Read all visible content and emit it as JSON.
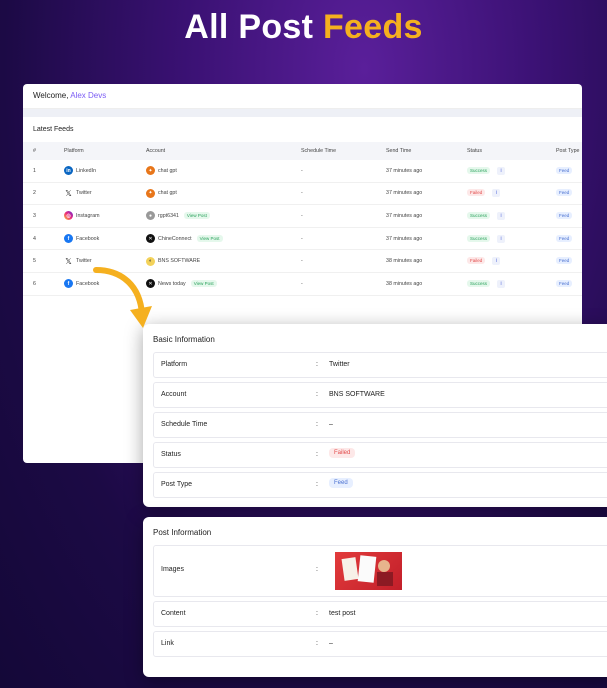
{
  "hero": {
    "title_plain": "All Post",
    "title_highlight": "Feeds"
  },
  "welcome": {
    "prefix": "Welcome,",
    "name": "Alex Devs"
  },
  "feeds": {
    "title": "Latest Feeds",
    "columns": [
      "#",
      "Platform",
      "Account",
      "Schedule Time",
      "Send Time",
      "Status",
      "Post Type"
    ],
    "rows": [
      {
        "n": "1",
        "platform": "LinkedIn",
        "platform_icon": "linkedin-icon",
        "account": "chat gpt",
        "avatar": "orange-avatar",
        "view_post": "",
        "schedule": "-",
        "send": "37 minutes ago",
        "status": "Success",
        "type": "Feed"
      },
      {
        "n": "2",
        "platform": "Twitter",
        "platform_icon": "x-icon",
        "account": "chat gpt",
        "avatar": "orange-avatar",
        "view_post": "",
        "schedule": "-",
        "send": "37 minutes ago",
        "status": "Failed",
        "type": "Feed"
      },
      {
        "n": "3",
        "platform": "Instagram",
        "platform_icon": "instagram-icon",
        "account": "rgpt6341",
        "avatar": "gray-avatar",
        "view_post": "View Post",
        "schedule": "-",
        "send": "37 minutes ago",
        "status": "Success",
        "type": "Feed"
      },
      {
        "n": "4",
        "platform": "Facebook",
        "platform_icon": "facebook-icon",
        "account": "ChineConnect",
        "avatar": "black-avatar",
        "view_post": "View Post",
        "schedule": "-",
        "send": "37 minutes ago",
        "status": "Success",
        "type": "Feed"
      },
      {
        "n": "5",
        "platform": "Twitter",
        "platform_icon": "x-icon",
        "account": "BNS SOFTWARE",
        "avatar": "yellow-avatar",
        "view_post": "",
        "schedule": "-",
        "send": "38 minutes ago",
        "status": "Failed",
        "type": "Feed"
      },
      {
        "n": "6",
        "platform": "Facebook",
        "platform_icon": "facebook-icon",
        "account": "News today",
        "avatar": "black-avatar",
        "view_post": "View Post",
        "schedule": "-",
        "send": "38 minutes ago",
        "status": "Success",
        "type": "Feed"
      }
    ]
  },
  "basic_info": {
    "title": "Basic Information",
    "platform_label": "Platform",
    "platform_value": "Twitter",
    "account_label": "Account",
    "account_value": "BNS SOFTWARE",
    "schedule_label": "Schedule Time",
    "schedule_value": "–",
    "status_label": "Status",
    "status_value": "Failed",
    "type_label": "Post Type",
    "type_value": "Feed"
  },
  "post_info": {
    "title": "Post Information",
    "images_label": "Images",
    "content_label": "Content",
    "content_value": "test post",
    "link_label": "Link",
    "link_value": "–"
  },
  "colon": ":",
  "colors": {
    "accent": "#f5b01f",
    "brand": "#7b5cf5",
    "success": "#28a05a",
    "failed": "#e24b4b"
  }
}
